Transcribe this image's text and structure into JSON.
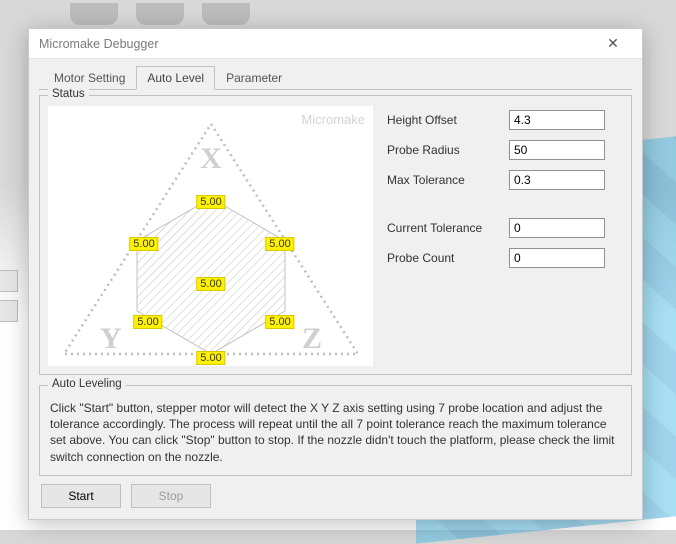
{
  "window": {
    "title": "Micromake Debugger"
  },
  "tabs": {
    "motor": "Motor Setting",
    "auto": "Auto Level",
    "param": "Parameter",
    "active": "Auto Level"
  },
  "status": {
    "legend": "Status",
    "watermark": "Micromake",
    "axes": {
      "x": "X",
      "y": "Y",
      "z": "Z"
    },
    "probes": {
      "top": "5.00",
      "left": "5.00",
      "right": "5.00",
      "center": "5.00",
      "bl": "5.00",
      "br": "5.00",
      "bottom": "5.00"
    }
  },
  "fields": {
    "height_offset": {
      "label": "Height Offset",
      "value": "4.3"
    },
    "probe_radius": {
      "label": "Probe Radius",
      "value": "50"
    },
    "max_tolerance": {
      "label": "Max Tolerance",
      "value": "0.3"
    },
    "current_tolerance": {
      "label": "Current Tolerance",
      "value": "0"
    },
    "probe_count": {
      "label": "Probe Count",
      "value": "0"
    }
  },
  "autolevel": {
    "legend": "Auto Leveling",
    "text": "Click \"Start\" button, stepper motor will detect the X Y Z axis setting using 7 probe location and adjust the tolerance accordingly. The process will repeat until the all 7 point tolerance reach the maximum tolerance set above. You can click \"Stop\" button to stop. If the nozzle didn't touch the platform, please check the limit switch connection on the nozzle."
  },
  "buttons": {
    "start": "Start",
    "stop": "Stop"
  }
}
